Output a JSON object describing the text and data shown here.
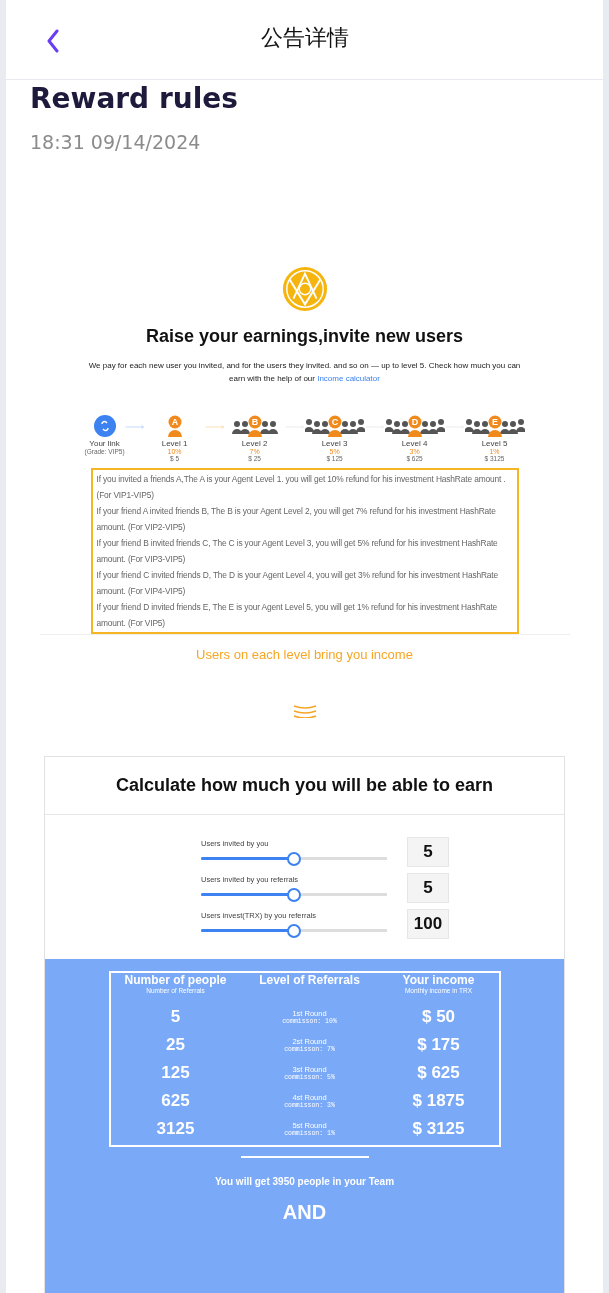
{
  "header": {
    "title": "公告详情"
  },
  "article": {
    "title": "Reward rules",
    "date": "18:31 09/14/2024"
  },
  "invite": {
    "heading": "Raise your earnings,invite new users",
    "intro": "We pay for each new user you invited, and for the users they invited. and so on — up to level 5. Check how much you can earn with the help of our",
    "link": "Income calculator",
    "levels": [
      {
        "kind": "link",
        "label": "Your link",
        "sub": "(Grade: VIP5)"
      },
      {
        "kind": "level",
        "badge": "A",
        "label": "Level 1",
        "percent": "10%",
        "amount": "$ 5"
      },
      {
        "kind": "level",
        "badge": "B",
        "label": "Level 2",
        "percent": "7%",
        "amount": "$ 25"
      },
      {
        "kind": "level",
        "badge": "C",
        "label": "Level 3",
        "percent": "5%",
        "amount": "$ 125"
      },
      {
        "kind": "level",
        "badge": "D",
        "label": "Level 4",
        "percent": "3%",
        "amount": "$ 625"
      },
      {
        "kind": "level",
        "badge": "E",
        "label": "Level 5",
        "percent": "1%",
        "amount": "$ 3125"
      }
    ],
    "rules": [
      "If you invited a friends A,The A is your Agent Level 1. you will get 10% refund for his investment HashRate amount .   (For VIP1-VIP5)",
      "If your friend A invited  friends B, The B is your Agent Level 2, you will get 7% refund for his investment HashRate amount.   (For VIP2-VIP5)",
      "If your friend B invited  friends C, The C is your Agent Level 3, you will get 5% refund for his investment HashRate amount.   (For VIP3-VIP5)",
      "If your friend C invited  friends D, The D is your Agent Level 4, you will get 3% refund for his investment HashRate amount.   (For VIP4-VIP5)",
      "If your friend D invited  friends E, The E is your Agent Level 5, you will get 1% refund for his investment HashRate amount.   (For VIP5)"
    ],
    "note": "Users on each level bring you income"
  },
  "calculator": {
    "title": "Calculate how much you will be able to earn",
    "sliders": [
      {
        "label": "Users invited by you",
        "level": 0.5,
        "value": "5"
      },
      {
        "label": "Users invited by you referrals",
        "level": 0.5,
        "value": "5"
      },
      {
        "label": "Users invest(TRX) by you referrals",
        "level": 0.5,
        "value": "100"
      }
    ],
    "columns": [
      {
        "title": "Number of people",
        "subtitle": "Number of Referrals"
      },
      {
        "title": "Level of Referrals"
      },
      {
        "title": "Your income",
        "subtitle": "Monthly income in TRX"
      }
    ],
    "rows": [
      {
        "people": "5",
        "round": "1st Round",
        "commission": "commisson: 10%",
        "income": "$ 50"
      },
      {
        "people": "25",
        "round": "2st Round",
        "commission": "commisson: 7%",
        "income": "$ 175"
      },
      {
        "people": "125",
        "round": "3st Round",
        "commission": "commisson: 5%",
        "income": "$ 625"
      },
      {
        "people": "625",
        "round": "4st Round",
        "commission": "commisson: 3%",
        "income": "$ 1875"
      },
      {
        "people": "3125",
        "round": "5st Round",
        "commission": "commisson: 1%",
        "income": "$ 3125"
      }
    ],
    "team_note": "You will get 3950 people in your Team",
    "and_text": "AND"
  }
}
